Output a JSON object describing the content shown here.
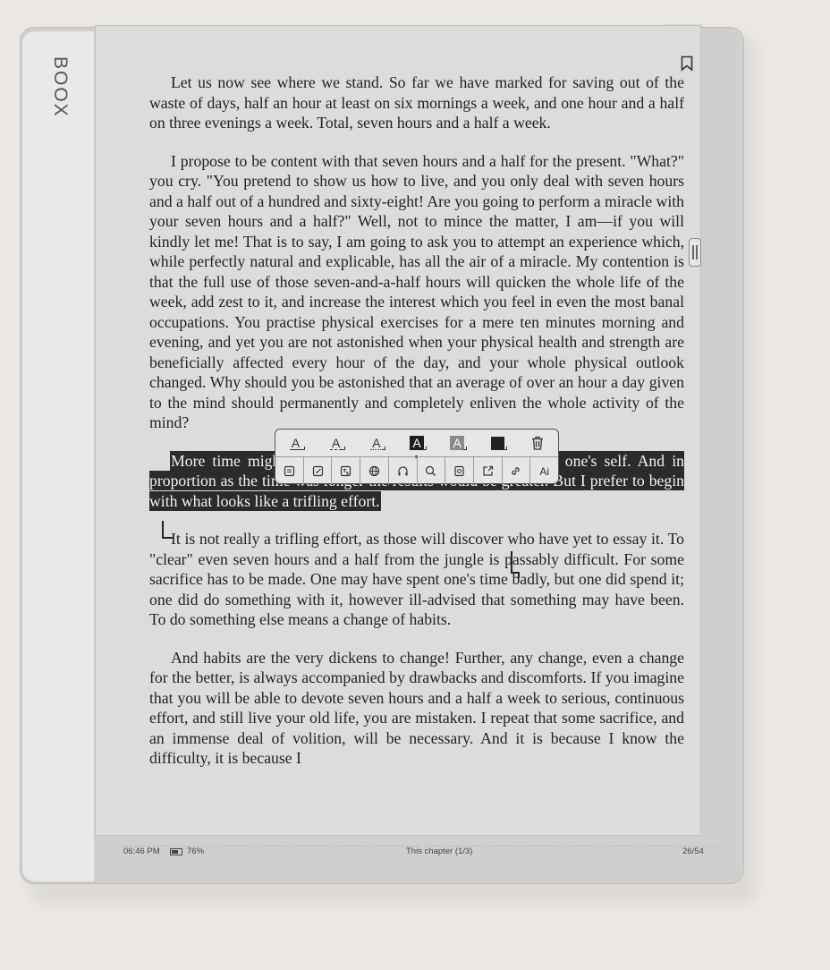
{
  "device": {
    "brand": "BOOX"
  },
  "reader": {
    "paragraphs": [
      "Let us now see where we stand. So far we have marked for saving out of the waste of days, half an hour at least on six mornings a week, and one hour and a half on three evenings a week. Total, seven hours and a half a week.",
      "I propose to be content with that seven hours and a half for the present. \"What?\" you cry. \"You pretend to show us how to live, and you only deal with seven hours and a half out of a hundred and sixty-eight! Are you going to perform a miracle with your seven hours and a half?\" Well, not to mince the matter, I am—if you will kindly let me! That is to say, I am going to ask you to attempt an experience which, while perfectly natural and explicable, has all the air of a miracle. My contention is that the full use of those seven-and-a-half hours will quicken the whole life of the week, add zest to it, and increase the interest which you feel in even the most banal occupations. You practise physical exercises for a mere ten minutes morning and evening, and yet you are not astonished when your physical health and strength are beneficially affected every hour of the day, and your whole physical outlook changed. Why should you be astonished that an average of over an hour a day given to the mind should permanently and completely enliven the whole activity of the mind?",
      "More time might assuredly be given to the cultivation of one's self. And in proportion as the time was longer the results would be greater. But I prefer to begin with what looks like a trifling effort.",
      "It is not really a trifling effort, as those will discover who have yet to essay it. To \"clear\" even seven hours and a half from the jungle is passably difficult. For some sacrifice has to be made. One may have spent one's time badly, but one did spend it; one did do something with it, however ill-advised that something may have been. To do something else means a change of habits.",
      "And habits are the very dickens to change! Further, any change, even a change for the better, is always accompanied by drawbacks and discomforts. If you imagine that you will be able to devote seven hours and a half a week to serious, continuous effort, and still live your old life, you are mistaken. I repeat that some sacrifice, and an immense deal of volition, will be necessary. And it is because I know the difficulty, it is because I"
    ]
  },
  "toolbar": {
    "format_letter": "A",
    "ai_label": "Ai"
  },
  "status": {
    "time": "06:46 PM",
    "battery": "76%",
    "chapter": "This chapter (1/3)",
    "page": "26/54"
  }
}
